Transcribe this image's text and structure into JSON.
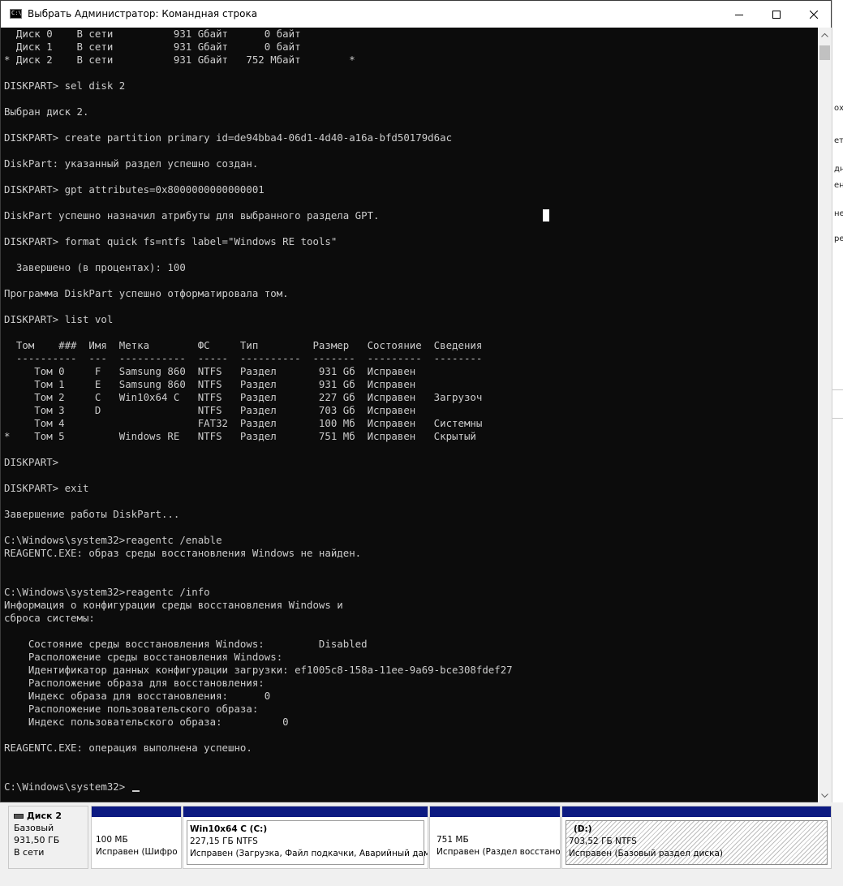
{
  "window": {
    "title": "Выбрать Администратор: Командная строка",
    "icon": "cmd-icon",
    "controls": [
      "minimize-icon",
      "maximize-icon",
      "close-icon"
    ]
  },
  "console": {
    "lines": [
      "  Диск 0    В сети          931 Gбайт      0 байт",
      "  Диск 1    В сети          931 Gбайт      0 байт",
      "* Диск 2    В сети          931 Gбайт   752 Мбайт        *",
      "",
      "DISKPART> sel disk 2",
      "",
      "Выбран диск 2.",
      "",
      "DISKPART> create partition primary id=de94bba4-06d1-4d40-a16a-bfd50179d6ac",
      "",
      "DiskPart: указанный раздел успешно создан.",
      "",
      "DISKPART> gpt attributes=0x8000000000000001",
      "",
      "DiskPart успешно назначил атрибуты для выбранного раздела GPT.",
      "",
      "DISKPART> format quick fs=ntfs label=\"Windows RE tools\"",
      "",
      "  Завершено (в процентах): 100",
      "",
      "Программа DiskPart успешно отформатировала том.",
      "",
      "DISKPART> list vol",
      "",
      "  Том    ###  Имя  Метка        ФС     Тип         Размер   Состояние  Сведения",
      "  ----------  ---  -----------  -----  ----------  -------  ---------  --------",
      "     Том 0     F   Samsung 860  NTFS   Раздел       931 Gб  Исправен",
      "     Том 1     E   Samsung 860  NTFS   Раздел       931 Gб  Исправен",
      "     Том 2     C   Win10x64 C   NTFS   Раздел       227 Gб  Исправен   Загрузоч",
      "     Том 3     D                NTFS   Раздел       703 Gб  Исправен",
      "     Том 4                      FAT32  Раздел       100 Мб  Исправен   Системны",
      "*    Том 5         Windows RE   NTFS   Раздел       751 Мб  Исправен   Скрытый",
      "",
      "DISKPART>",
      "",
      "DISKPART> exit",
      "",
      "Завершение работы DiskPart...",
      "",
      "C:\\Windows\\system32>reagentc /enable",
      "REAGENTC.EXE: образ среды восстановления Windows не найден.",
      "",
      "",
      "C:\\Windows\\system32>reagentc /info",
      "Информация о конфигурации среды восстановления Windows и",
      "сброса системы:",
      "",
      "    Состояние среды восстановления Windows:         Disabled",
      "    Расположение среды восстановления Windows:",
      "    Идентификатор данных конфигурации загрузки: ef1005c8-158a-11ee-9a69-bce308fdef27",
      "    Расположение образа для восстановления:",
      "    Индекс образа для восстановления:      0",
      "    Расположение пользовательского образа:",
      "    Индекс пользовательского образа:          0",
      "",
      "REAGENTC.EXE: операция выполнена успешно.",
      "",
      "",
      "C:\\Windows\\system32>"
    ]
  },
  "background_fragments": [
    "ох",
    "етс",
    "дн",
    "ен",
    "не",
    "ре"
  ],
  "disk_panel": {
    "disk": {
      "icon": "disk-icon",
      "name": "Диск 2",
      "type": "Базовый",
      "size": "931,50 ГБ",
      "status": "В сети"
    },
    "partitions": [
      {
        "name": "",
        "size": "100 МБ",
        "status": "Исправен (Шифро",
        "style": "normal"
      },
      {
        "name": "Win10x64 C  (C:)",
        "size": "227,15 ГБ NTFS",
        "status": "Исправен (Загрузка, Файл подкачки, Аварийный дам",
        "style": "selected"
      },
      {
        "name": "",
        "size": "751 МБ",
        "status": "Исправен (Раздел восстано",
        "style": "normal"
      },
      {
        "name": "(D:)",
        "size": "703,52 ГБ NTFS",
        "status": "Исправен (Базовый раздел диска)",
        "style": "hatched"
      }
    ],
    "colors": {
      "partition_bar": "#0c1a82",
      "console_bg": "#0c0c0c",
      "console_fg": "#cccccc"
    }
  }
}
